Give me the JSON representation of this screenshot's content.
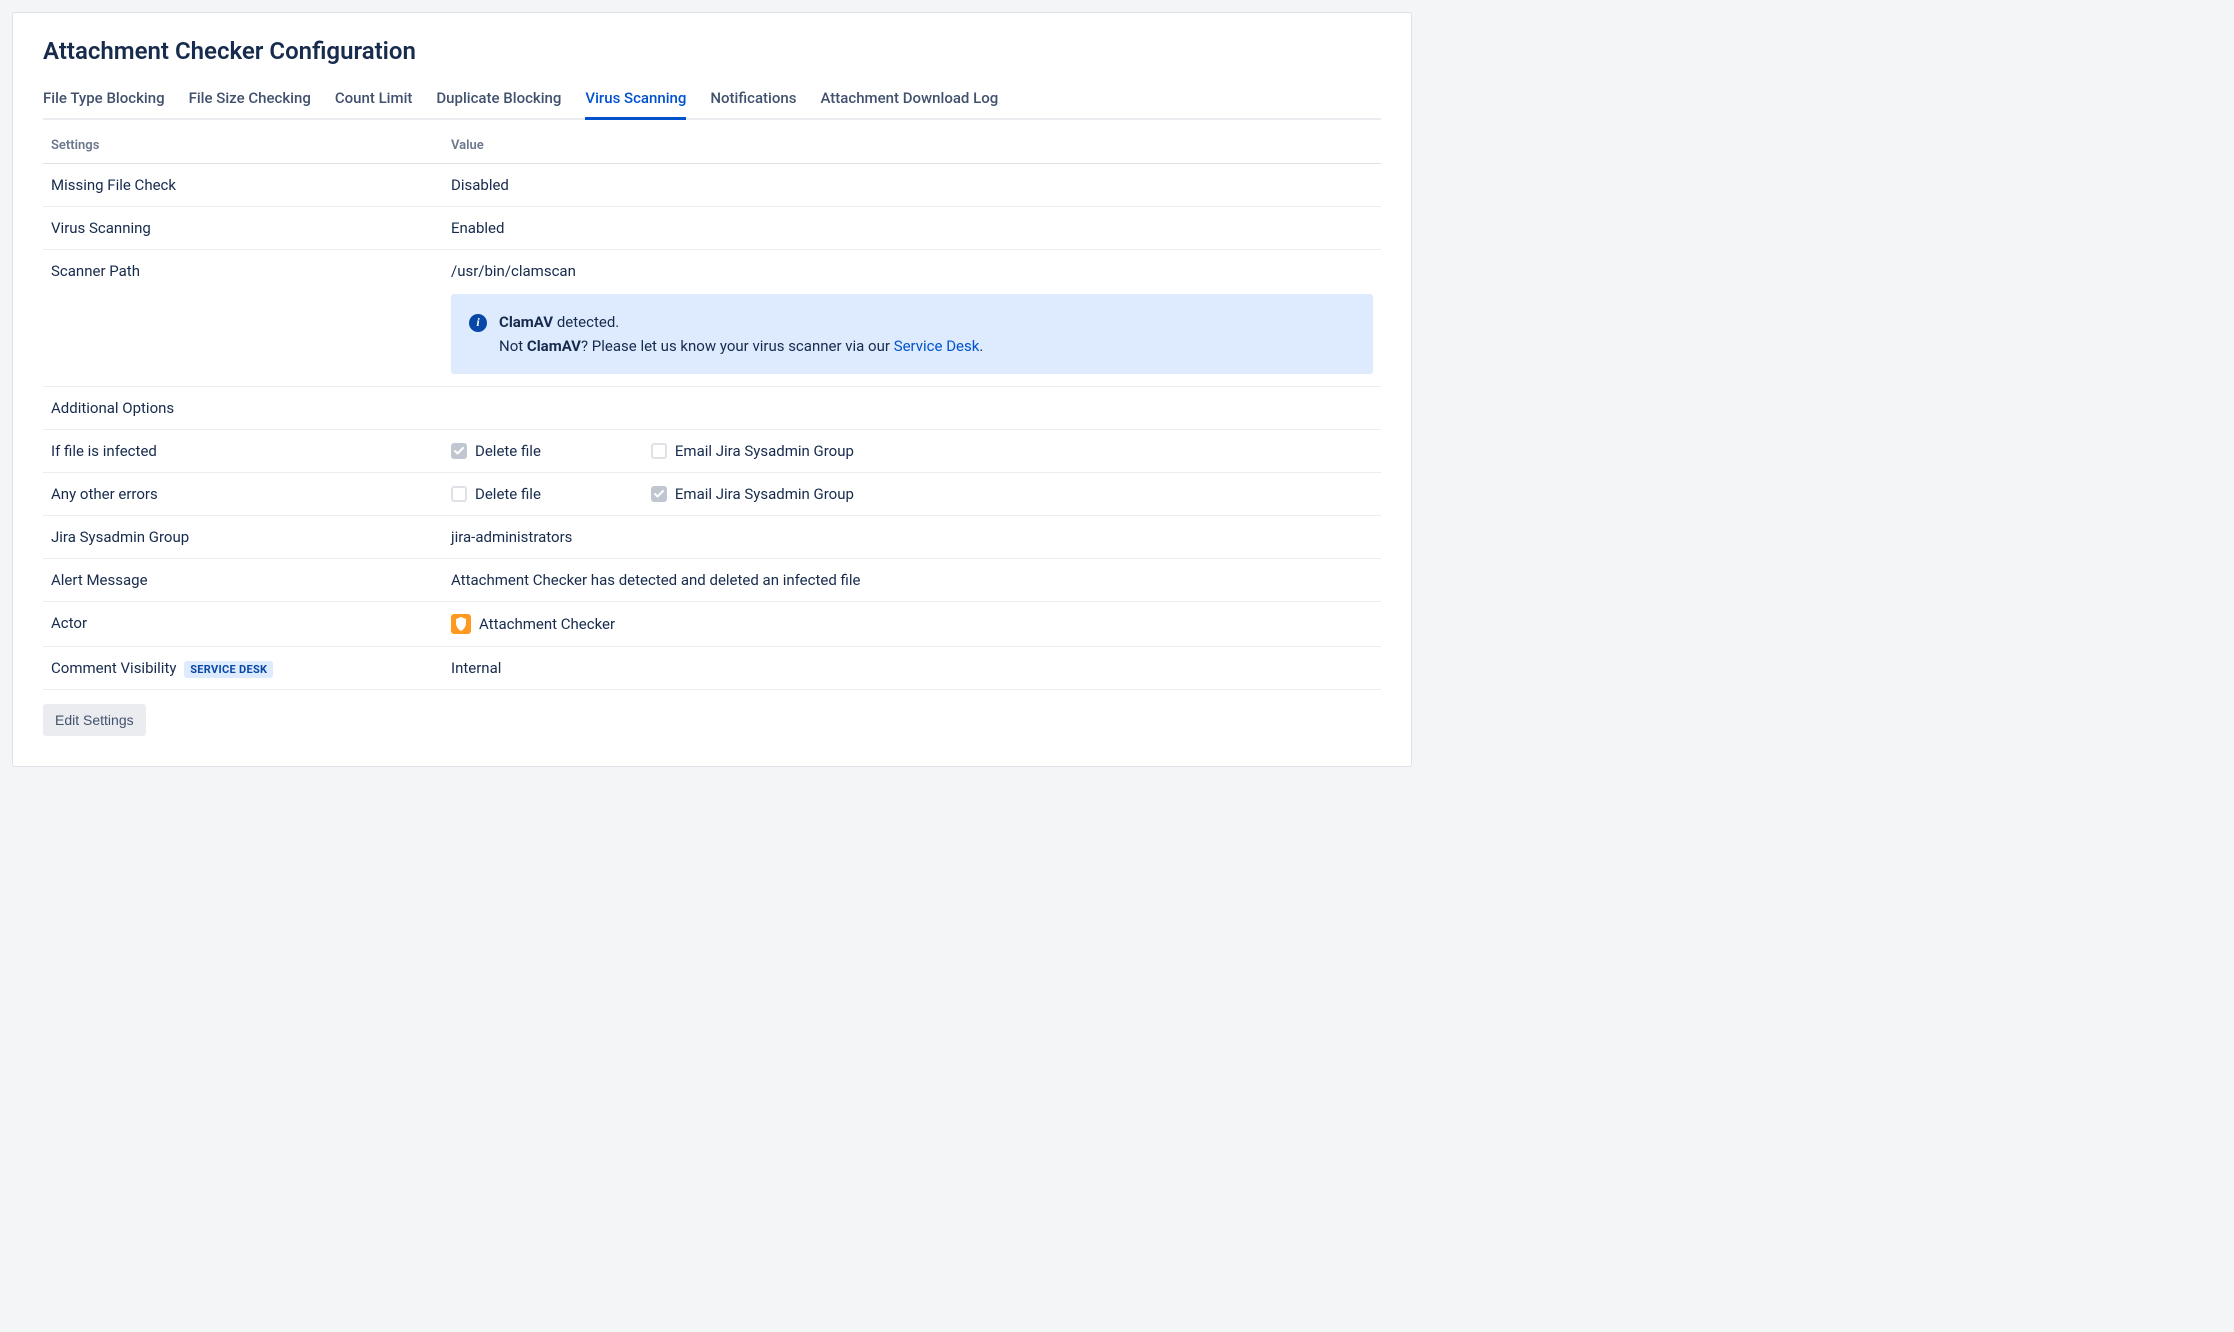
{
  "page": {
    "title": "Attachment Checker Configuration"
  },
  "tabs": [
    {
      "label": "File Type Blocking",
      "active": false
    },
    {
      "label": "File Size Checking",
      "active": false
    },
    {
      "label": "Count Limit",
      "active": false
    },
    {
      "label": "Duplicate Blocking",
      "active": false
    },
    {
      "label": "Virus Scanning",
      "active": true
    },
    {
      "label": "Notifications",
      "active": false
    },
    {
      "label": "Attachment Download Log",
      "active": false
    }
  ],
  "table": {
    "header_settings": "Settings",
    "header_value": "Value",
    "missing_file_check": {
      "label": "Missing File Check",
      "value": "Disabled"
    },
    "virus_scanning": {
      "label": "Virus Scanning",
      "value": "Enabled"
    },
    "scanner_path": {
      "label": "Scanner Path",
      "value": "/usr/bin/clamscan"
    },
    "info": {
      "strong1": "ClamAV",
      "detected_suffix": " detected.",
      "not_prefix": "Not ",
      "strong2": "ClamAV",
      "not_suffix": "? Please let us know your virus scanner via our ",
      "link_text": "Service Desk",
      "period": "."
    },
    "additional_options": "Additional Options",
    "if_infected": {
      "label": "If file is infected",
      "delete_label": "Delete file",
      "delete_checked": true,
      "email_label": "Email Jira Sysadmin Group",
      "email_checked": false
    },
    "other_errors": {
      "label": "Any other errors",
      "delete_label": "Delete file",
      "delete_checked": false,
      "email_label": "Email Jira Sysadmin Group",
      "email_checked": true
    },
    "sysadmin_group": {
      "label": "Jira Sysadmin Group",
      "value": "jira-administrators"
    },
    "alert_message": {
      "label": "Alert Message",
      "value": "Attachment Checker has detected and deleted an infected file"
    },
    "actor": {
      "label": "Actor",
      "value": "Attachment Checker"
    },
    "comment_visibility": {
      "label": "Comment Visibility",
      "badge": "SERVICE DESK",
      "value": "Internal"
    }
  },
  "buttons": {
    "edit_settings": "Edit Settings"
  }
}
